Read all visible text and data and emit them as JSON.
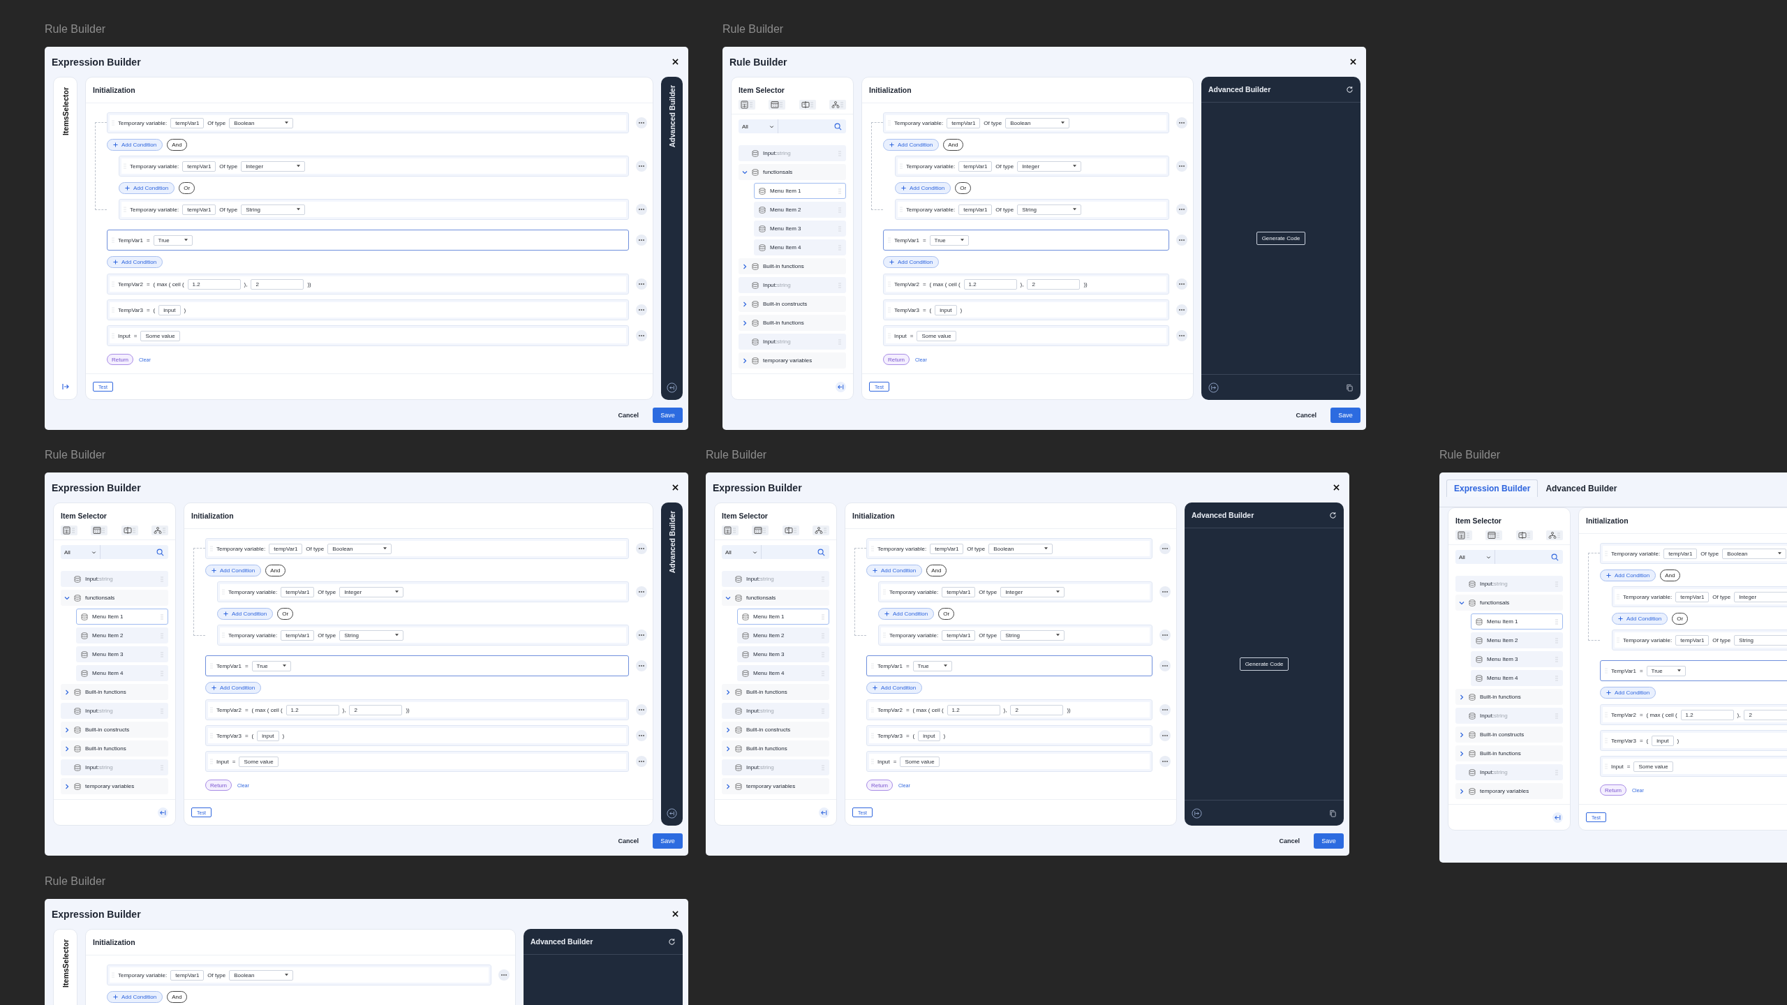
{
  "frames": [
    {
      "caption": "Rule Builder",
      "header": {
        "kind": "title",
        "title": "Expression Builder"
      },
      "selector": {
        "kind": "collapsed",
        "label": "ItemsSelector"
      },
      "init": {
        "title": "Initialization",
        "rows": [
          {
            "kind": "declare",
            "focused": false,
            "label": "Temporary variable:",
            "value": "tempVar1",
            "of": "Of type",
            "type": "Boolean",
            "add": "Add Condition",
            "op": "And",
            "children": [
              {
                "kind": "declare",
                "focused": false,
                "label": "Temporary variable:",
                "value": "tempVar1",
                "of": "Of type",
                "type": "Integer",
                "add": "Add Condition",
                "op": "Or"
              },
              {
                "kind": "declare",
                "focused": false,
                "label": "Temporary variable:",
                "value": "tempVar1",
                "of": "Of type",
                "type": "String"
              }
            ]
          },
          {
            "kind": "expr",
            "focused": true,
            "name": "TempVar1",
            "eq": "=",
            "parts": [
              {
                "kind": "select",
                "text": "True"
              }
            ],
            "add": "Add Condition"
          },
          {
            "kind": "expr",
            "focused": false,
            "name": "TempVar2",
            "eq": "=",
            "parts": [
              {
                "kind": "text",
                "text": "( max ( ceil ("
              },
              {
                "kind": "number",
                "text": "1.2"
              },
              {
                "kind": "text",
                "text": "),"
              },
              {
                "kind": "number",
                "text": "2"
              },
              {
                "kind": "text",
                "text": "))"
              }
            ]
          },
          {
            "kind": "expr",
            "focused": false,
            "name": "TempVar3",
            "eq": "=",
            "parts": [
              {
                "kind": "text",
                "text": "("
              },
              {
                "kind": "field",
                "text": "input"
              },
              {
                "kind": "text",
                "text": ")"
              }
            ]
          },
          {
            "kind": "expr",
            "focused": false,
            "name": "Input",
            "eq": "=",
            "parts": [
              {
                "kind": "field",
                "text": "Some value"
              }
            ]
          }
        ],
        "return": "Return",
        "clear": "Clear",
        "test": "Test"
      },
      "advanced": {
        "kind": "collapsed",
        "label": "Advanced Builder"
      },
      "footer": {
        "cancel": "Cancel",
        "save": "Save"
      }
    },
    {
      "caption": "Rule Builder",
      "header": {
        "kind": "title",
        "title": "Rule Builder"
      },
      "selector": {
        "kind": "panel",
        "title": "Item Selector",
        "filter": "All",
        "items": [
          {
            "kind": "leaf",
            "label": "Input:",
            "type": "string",
            "selected": false
          },
          {
            "kind": "group",
            "label": "functionsals",
            "expanded": true,
            "selected": false,
            "children": [
              {
                "kind": "leaf",
                "label": "Menu Item 1",
                "selected": true
              },
              {
                "kind": "leaf",
                "label": "Menu Item 2",
                "selected": false
              },
              {
                "kind": "leaf",
                "label": "Menu Item 3",
                "selected": false
              },
              {
                "kind": "leaf",
                "label": "Menu Item 4",
                "selected": false
              }
            ]
          },
          {
            "kind": "group",
            "label": "Built-in functions",
            "expanded": false,
            "selected": false
          },
          {
            "kind": "leaf",
            "label": "Input:",
            "type": "string",
            "selected": false
          },
          {
            "kind": "group",
            "label": "Built-in constructs",
            "expanded": false,
            "selected": false
          },
          {
            "kind": "group",
            "label": "Built-in functions",
            "expanded": false,
            "selected": false
          },
          {
            "kind": "leaf",
            "label": "Input:",
            "type": "string",
            "selected": false
          },
          {
            "kind": "group",
            "label": "temporary variables",
            "expanded": false,
            "selected": false
          }
        ]
      },
      "init": {
        "title": "Initialization",
        "rows": [
          {
            "kind": "declare",
            "focused": false,
            "label": "Temporary variable:",
            "value": "tempVar1",
            "of": "Of type",
            "type": "Boolean",
            "add": "Add Condition",
            "op": "And",
            "children": [
              {
                "kind": "declare",
                "focused": false,
                "label": "Temporary variable:",
                "value": "tempVar1",
                "of": "Of type",
                "type": "Integer",
                "add": "Add Condition",
                "op": "Or"
              },
              {
                "kind": "declare",
                "focused": false,
                "label": "Temporary variable:",
                "value": "tempVar1",
                "of": "Of type",
                "type": "String"
              }
            ]
          },
          {
            "kind": "expr",
            "focused": true,
            "name": "TempVar1",
            "eq": "=",
            "parts": [
              {
                "kind": "select",
                "text": "True"
              }
            ],
            "add": "Add Condition"
          },
          {
            "kind": "expr",
            "focused": false,
            "name": "TempVar2",
            "eq": "=",
            "parts": [
              {
                "kind": "text",
                "text": "( max ( ceil ("
              },
              {
                "kind": "number",
                "text": "1.2"
              },
              {
                "kind": "text",
                "text": "),"
              },
              {
                "kind": "number",
                "text": "2"
              },
              {
                "kind": "text",
                "text": "))"
              }
            ]
          },
          {
            "kind": "expr",
            "focused": false,
            "name": "TempVar3",
            "eq": "=",
            "parts": [
              {
                "kind": "text",
                "text": "("
              },
              {
                "kind": "field",
                "text": "input"
              },
              {
                "kind": "text",
                "text": ")"
              }
            ]
          },
          {
            "kind": "expr",
            "focused": false,
            "name": "Input",
            "eq": "=",
            "parts": [
              {
                "kind": "field",
                "text": "Some value"
              }
            ]
          }
        ],
        "return": "Return",
        "clear": "Clear",
        "test": "Test"
      },
      "advanced": {
        "kind": "panel",
        "title": "Advanced Builder",
        "action": "Generate Code"
      },
      "footer": {
        "cancel": "Cancel",
        "save": "Save"
      }
    },
    {
      "caption": "Rule Builder",
      "header": {
        "kind": "title",
        "title": "Expression Builder"
      },
      "selector": {
        "kind": "panel",
        "title": "Item Selector",
        "filter": "All",
        "items": [
          {
            "kind": "leaf",
            "label": "Input:",
            "type": "string",
            "selected": false
          },
          {
            "kind": "group",
            "label": "functionsals",
            "expanded": true,
            "selected": false,
            "children": [
              {
                "kind": "leaf",
                "label": "Menu Item 1",
                "selected": true
              },
              {
                "kind": "leaf",
                "label": "Menu Item 2",
                "selected": false
              },
              {
                "kind": "leaf",
                "label": "Menu Item 3",
                "selected": false
              },
              {
                "kind": "leaf",
                "label": "Menu Item 4",
                "selected": false
              }
            ]
          },
          {
            "kind": "group",
            "label": "Built-in functions",
            "expanded": false,
            "selected": false
          },
          {
            "kind": "leaf",
            "label": "Input:",
            "type": "string",
            "selected": false
          },
          {
            "kind": "group",
            "label": "Built-in constructs",
            "expanded": false,
            "selected": false
          },
          {
            "kind": "group",
            "label": "Built-in functions",
            "expanded": false,
            "selected": false
          },
          {
            "kind": "leaf",
            "label": "Input:",
            "type": "string",
            "selected": false
          },
          {
            "kind": "group",
            "label": "temporary variables",
            "expanded": false,
            "selected": false
          }
        ]
      },
      "init": {
        "title": "Initialization",
        "rows": [
          {
            "kind": "declare",
            "focused": false,
            "label": "Temporary variable:",
            "value": "tempVar1",
            "of": "Of type",
            "type": "Boolean",
            "add": "Add Condition",
            "op": "And",
            "children": [
              {
                "kind": "declare",
                "focused": false,
                "label": "Temporary variable:",
                "value": "tempVar1",
                "of": "Of type",
                "type": "Integer",
                "add": "Add Condition",
                "op": "Or"
              },
              {
                "kind": "declare",
                "focused": false,
                "label": "Temporary variable:",
                "value": "tempVar1",
                "of": "Of type",
                "type": "String"
              }
            ]
          },
          {
            "kind": "expr",
            "focused": true,
            "name": "TempVar1",
            "eq": "=",
            "parts": [
              {
                "kind": "select",
                "text": "True"
              }
            ],
            "add": "Add Condition"
          },
          {
            "kind": "expr",
            "focused": false,
            "name": "TempVar2",
            "eq": "=",
            "parts": [
              {
                "kind": "text",
                "text": "( max ( ceil ("
              },
              {
                "kind": "number",
                "text": "1.2"
              },
              {
                "kind": "text",
                "text": "),"
              },
              {
                "kind": "number",
                "text": "2"
              },
              {
                "kind": "text",
                "text": "))"
              }
            ]
          },
          {
            "kind": "expr",
            "focused": false,
            "name": "TempVar3",
            "eq": "=",
            "parts": [
              {
                "kind": "text",
                "text": "("
              },
              {
                "kind": "field",
                "text": "input"
              },
              {
                "kind": "text",
                "text": ")"
              }
            ]
          },
          {
            "kind": "expr",
            "focused": false,
            "name": "Input",
            "eq": "=",
            "parts": [
              {
                "kind": "field",
                "text": "Some value"
              }
            ]
          }
        ],
        "return": "Return",
        "clear": "Clear",
        "test": "Test"
      },
      "advanced": {
        "kind": "collapsed",
        "label": "Advanced Builder"
      },
      "footer": {
        "cancel": "Cancel",
        "save": "Save"
      }
    },
    {
      "caption": "Rule Builder",
      "header": {
        "kind": "title",
        "title": "Expression Builder"
      },
      "selector": {
        "kind": "panel",
        "title": "Item Selector",
        "filter": "All",
        "items": [
          {
            "kind": "leaf",
            "label": "Input:",
            "type": "string",
            "selected": false
          },
          {
            "kind": "group",
            "label": "functionsals",
            "expanded": true,
            "selected": false,
            "children": [
              {
                "kind": "leaf",
                "label": "Menu Item 1",
                "selected": true
              },
              {
                "kind": "leaf",
                "label": "Menu Item 2",
                "selected": false
              },
              {
                "kind": "leaf",
                "label": "Menu Item 3",
                "selected": false
              },
              {
                "kind": "leaf",
                "label": "Menu Item 4",
                "selected": false
              }
            ]
          },
          {
            "kind": "group",
            "label": "Built-in functions",
            "expanded": false,
            "selected": false
          },
          {
            "kind": "leaf",
            "label": "Input:",
            "type": "string",
            "selected": false
          },
          {
            "kind": "group",
            "label": "Built-in constructs",
            "expanded": false,
            "selected": false
          },
          {
            "kind": "group",
            "label": "Built-in functions",
            "expanded": false,
            "selected": false
          },
          {
            "kind": "leaf",
            "label": "Input:",
            "type": "string",
            "selected": false
          },
          {
            "kind": "group",
            "label": "temporary variables",
            "expanded": false,
            "selected": false
          }
        ]
      },
      "init": {
        "title": "Initialization",
        "rows": [
          {
            "kind": "declare",
            "focused": false,
            "label": "Temporary variable:",
            "value": "tempVar1",
            "of": "Of type",
            "type": "Boolean",
            "add": "Add Condition",
            "op": "And",
            "children": [
              {
                "kind": "declare",
                "focused": false,
                "label": "Temporary variable:",
                "value": "tempVar1",
                "of": "Of type",
                "type": "Integer",
                "add": "Add Condition",
                "op": "Or"
              },
              {
                "kind": "declare",
                "focused": false,
                "label": "Temporary variable:",
                "value": "tempVar1",
                "of": "Of type",
                "type": "String"
              }
            ]
          },
          {
            "kind": "expr",
            "focused": true,
            "name": "TempVar1",
            "eq": "=",
            "parts": [
              {
                "kind": "select",
                "text": "True"
              }
            ],
            "add": "Add Condition"
          },
          {
            "kind": "expr",
            "focused": false,
            "name": "TempVar2",
            "eq": "=",
            "parts": [
              {
                "kind": "text",
                "text": "( max ( ceil ("
              },
              {
                "kind": "number",
                "text": "1.2"
              },
              {
                "kind": "text",
                "text": "),"
              },
              {
                "kind": "number",
                "text": "2"
              },
              {
                "kind": "text",
                "text": "))"
              }
            ]
          },
          {
            "kind": "expr",
            "focused": false,
            "name": "TempVar3",
            "eq": "=",
            "parts": [
              {
                "kind": "text",
                "text": "("
              },
              {
                "kind": "field",
                "text": "input"
              },
              {
                "kind": "text",
                "text": ")"
              }
            ]
          },
          {
            "kind": "expr",
            "focused": false,
            "name": "Input",
            "eq": "=",
            "parts": [
              {
                "kind": "field",
                "text": "Some value"
              }
            ]
          }
        ],
        "return": "Return",
        "clear": "Clear",
        "test": "Test"
      },
      "advanced": {
        "kind": "panel",
        "title": "Advanced Builder",
        "action": "Generate Code"
      },
      "footer": {
        "cancel": "Cancel",
        "save": "Save"
      }
    },
    {
      "caption": "Rule Builder",
      "header": {
        "kind": "tabs",
        "tabs": [
          {
            "label": "Expression Builder",
            "selected": true
          },
          {
            "label": "Advanced Builder",
            "selected": false
          }
        ]
      },
      "selector": {
        "kind": "panel",
        "title": "Item Selector",
        "filter": "All",
        "items": [
          {
            "kind": "leaf",
            "label": "Input:",
            "type": "string",
            "selected": false
          },
          {
            "kind": "group",
            "label": "functionsals",
            "expanded": true,
            "selected": false,
            "children": [
              {
                "kind": "leaf",
                "label": "Menu Item 1",
                "selected": true
              },
              {
                "kind": "leaf",
                "label": "Menu Item 2",
                "selected": false
              },
              {
                "kind": "leaf",
                "label": "Menu Item 3",
                "selected": false
              },
              {
                "kind": "leaf",
                "label": "Menu Item 4",
                "selected": false
              }
            ]
          },
          {
            "kind": "group",
            "label": "Built-in functions",
            "expanded": false,
            "selected": false
          },
          {
            "kind": "leaf",
            "label": "Input:",
            "type": "string",
            "selected": false
          },
          {
            "kind": "group",
            "label": "Built-in constructs",
            "expanded": false,
            "selected": false
          },
          {
            "kind": "group",
            "label": "Built-in functions",
            "expanded": false,
            "selected": false
          },
          {
            "kind": "leaf",
            "label": "Input:",
            "type": "string",
            "selected": false
          },
          {
            "kind": "group",
            "label": "temporary variables",
            "expanded": false,
            "selected": false
          }
        ]
      },
      "init": {
        "title": "Initialization",
        "rows": [
          {
            "kind": "declare",
            "focused": false,
            "label": "Temporary variable:",
            "value": "tempVar1",
            "of": "Of type",
            "type": "Boolean",
            "add": "Add Condition",
            "op": "And",
            "children": [
              {
                "kind": "declare",
                "focused": false,
                "label": "Temporary variable:",
                "value": "tempVar1",
                "of": "Of type",
                "type": "Integer",
                "add": "Add Condition",
                "op": "Or"
              },
              {
                "kind": "declare",
                "focused": false,
                "label": "Temporary variable:",
                "value": "tempVar1",
                "of": "Of type",
                "type": "String"
              }
            ]
          },
          {
            "kind": "expr",
            "focused": true,
            "name": "TempVar1",
            "eq": "=",
            "parts": [
              {
                "kind": "select",
                "text": "True"
              }
            ],
            "add": "Add Condition"
          },
          {
            "kind": "expr",
            "focused": false,
            "name": "TempVar2",
            "eq": "=",
            "parts": [
              {
                "kind": "text",
                "text": "( max ( ceil ("
              },
              {
                "kind": "number",
                "text": "1.2"
              },
              {
                "kind": "text",
                "text": "),"
              },
              {
                "kind": "number",
                "text": "2"
              }
            ]
          },
          {
            "kind": "expr",
            "focused": false,
            "name": "TempVar3",
            "eq": "=",
            "parts": [
              {
                "kind": "text",
                "text": "("
              },
              {
                "kind": "field",
                "text": "input"
              },
              {
                "kind": "text",
                "text": ")"
              }
            ]
          },
          {
            "kind": "expr",
            "focused": false,
            "name": "Input",
            "eq": "=",
            "parts": [
              {
                "kind": "field",
                "text": "Some value"
              }
            ]
          }
        ],
        "return": "Return",
        "clear": "Clear",
        "test": "Test"
      }
    },
    {
      "caption": "Rule Builder",
      "header": {
        "kind": "title",
        "title": "Expression Builder"
      },
      "selector": {
        "kind": "collapsed",
        "label": "ItemsSelector"
      },
      "init": {
        "title": "Initialization",
        "rows": [
          {
            "kind": "declare",
            "focused": false,
            "label": "Temporary variable:",
            "value": "tempVar1",
            "of": "Of type",
            "type": "Boolean",
            "add": "Add Condition",
            "op": "And"
          }
        ]
      },
      "advanced": {
        "kind": "panel",
        "title": "Advanced Builder"
      }
    }
  ]
}
